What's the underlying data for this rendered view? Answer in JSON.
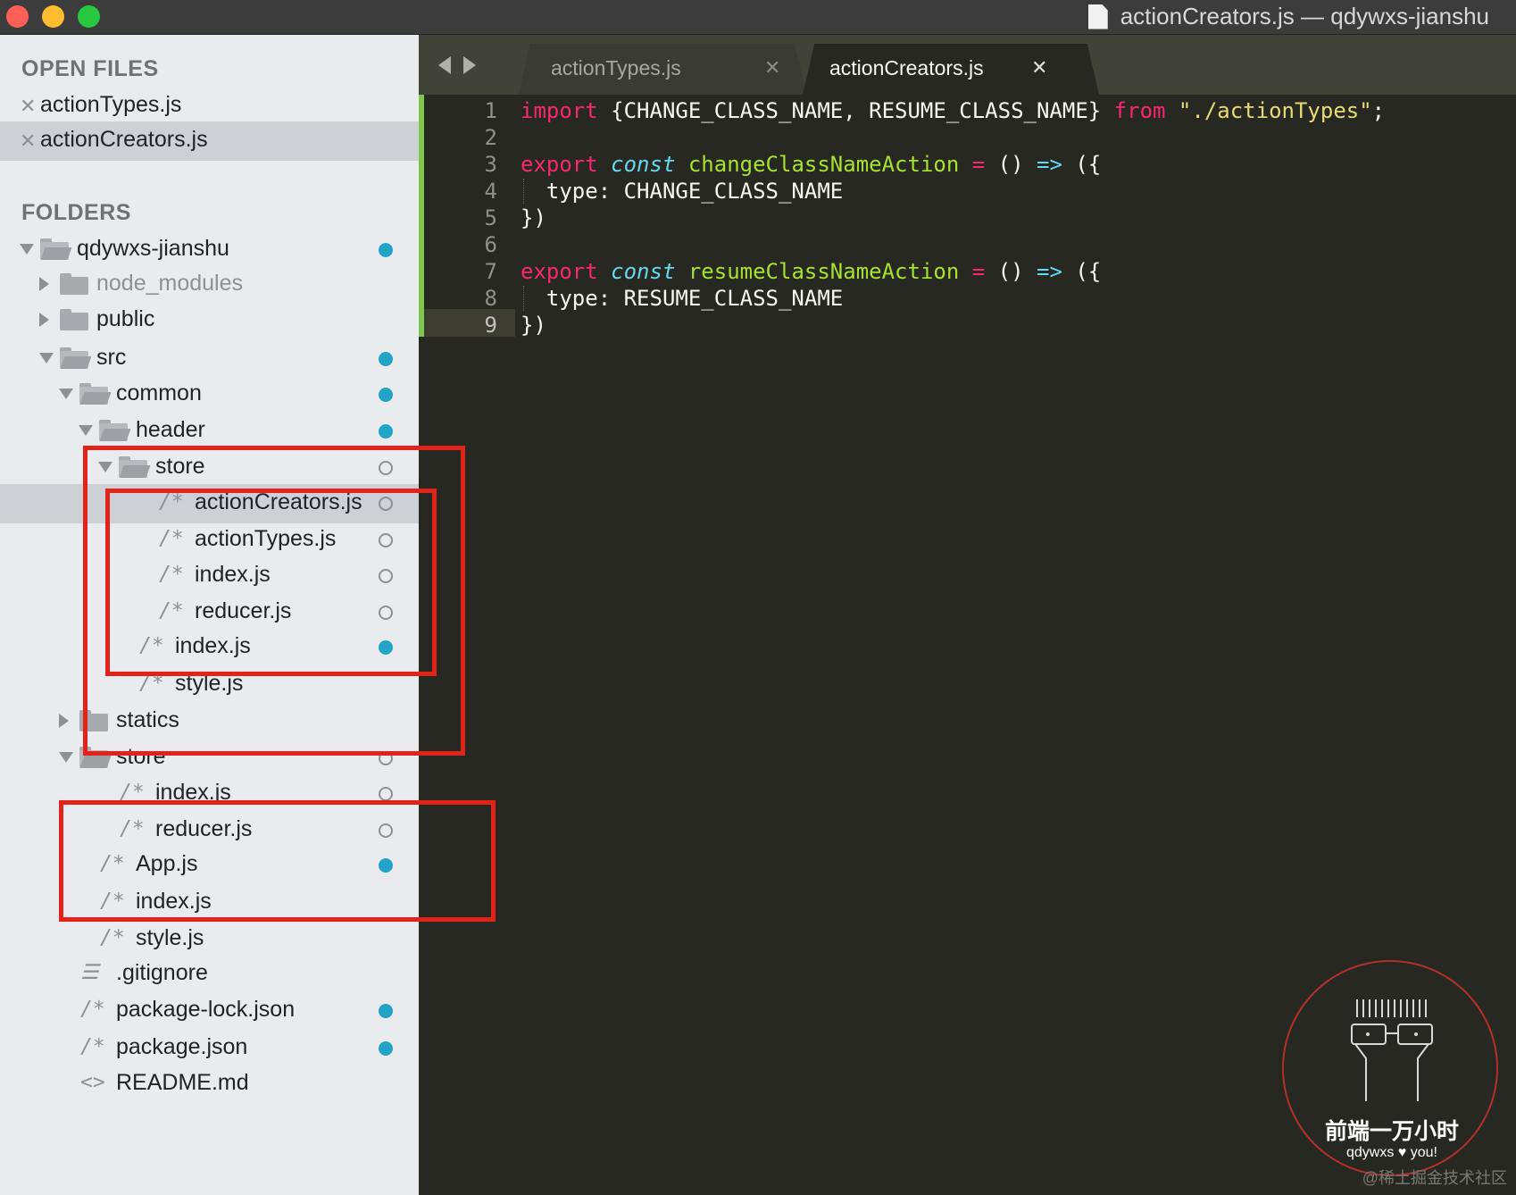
{
  "window": {
    "title": "actionCreators.js — qdywxs-jianshu"
  },
  "sidebar": {
    "open_files_heading": "OPEN FILES",
    "open_files": [
      {
        "label": "actionTypes.js",
        "selected": false
      },
      {
        "label": "actionCreators.js",
        "selected": true
      }
    ],
    "folders_heading": "FOLDERS",
    "tree": [
      {
        "label": "qdywxs-jianshu",
        "kind": "folder",
        "state": "open",
        "marker": "dot"
      },
      {
        "label": "node_modules",
        "kind": "folder",
        "state": "closed",
        "marker": "none",
        "dim": true
      },
      {
        "label": "public",
        "kind": "folder",
        "state": "closed",
        "marker": "none"
      },
      {
        "label": "src",
        "kind": "folder",
        "state": "open",
        "marker": "dot"
      },
      {
        "label": "common",
        "kind": "folder",
        "state": "open",
        "marker": "dot"
      },
      {
        "label": "header",
        "kind": "folder",
        "state": "open",
        "marker": "dot"
      },
      {
        "label": "store",
        "kind": "folder",
        "state": "open",
        "marker": "ring"
      },
      {
        "label": "actionCreators.js",
        "kind": "file",
        "icon": "/*",
        "marker": "ring",
        "selected": true
      },
      {
        "label": "actionTypes.js",
        "kind": "file",
        "icon": "/*",
        "marker": "ring"
      },
      {
        "label": "index.js",
        "kind": "file",
        "icon": "/*",
        "marker": "ring"
      },
      {
        "label": "reducer.js",
        "kind": "file",
        "icon": "/*",
        "marker": "ring"
      },
      {
        "label": "index.js",
        "kind": "file",
        "icon": "/*",
        "marker": "dot"
      },
      {
        "label": "style.js",
        "kind": "file",
        "icon": "/*",
        "marker": "none"
      },
      {
        "label": "statics",
        "kind": "folder",
        "state": "closed",
        "marker": "none"
      },
      {
        "label": "store",
        "kind": "folder",
        "state": "open",
        "marker": "ring"
      },
      {
        "label": "index.js",
        "kind": "file",
        "icon": "/*",
        "marker": "ring"
      },
      {
        "label": "reducer.js",
        "kind": "file",
        "icon": "/*",
        "marker": "ring"
      },
      {
        "label": "App.js",
        "kind": "file",
        "icon": "/*",
        "marker": "dot"
      },
      {
        "label": "index.js",
        "kind": "file",
        "icon": "/*",
        "marker": "none"
      },
      {
        "label": "style.js",
        "kind": "file",
        "icon": "/*",
        "marker": "none"
      },
      {
        "label": ".gitignore",
        "kind": "file",
        "icon": "lines",
        "marker": "none"
      },
      {
        "label": "package-lock.json",
        "kind": "file",
        "icon": "/*",
        "marker": "dot"
      },
      {
        "label": "package.json",
        "kind": "file",
        "icon": "/*",
        "marker": "dot"
      },
      {
        "label": "README.md",
        "kind": "file",
        "icon": "<>",
        "marker": "none"
      }
    ]
  },
  "editor": {
    "tabs": [
      {
        "label": "actionTypes.js",
        "active": false,
        "close": "✕"
      },
      {
        "label": "actionCreators.js",
        "active": true,
        "close": "✕"
      }
    ],
    "current_line": 9,
    "lines": [
      {
        "num": "1",
        "tokens": [
          [
            "k",
            "import"
          ],
          [
            "p",
            " {CHANGE_CLASS_NAME, RESUME_CLASS_NAME} "
          ],
          [
            "k",
            "from"
          ],
          [
            "p",
            " "
          ],
          [
            "s",
            "\"./actionTypes\""
          ],
          [
            "p",
            ";"
          ]
        ]
      },
      {
        "num": "2",
        "tokens": []
      },
      {
        "num": "3",
        "tokens": [
          [
            "k",
            "export"
          ],
          [
            "p",
            " "
          ],
          [
            "c",
            "const"
          ],
          [
            "p",
            " "
          ],
          [
            "f",
            "changeClassNameAction"
          ],
          [
            "p",
            " "
          ],
          [
            "k",
            "="
          ],
          [
            "p",
            " () "
          ],
          [
            "o",
            "=>"
          ],
          [
            "p",
            " ({"
          ]
        ]
      },
      {
        "num": "4",
        "tokens": [
          [
            "p",
            "  type: CHANGE_CLASS_NAME"
          ]
        ],
        "guide": true
      },
      {
        "num": "5",
        "tokens": [
          [
            "p",
            "})"
          ]
        ]
      },
      {
        "num": "6",
        "tokens": []
      },
      {
        "num": "7",
        "tokens": [
          [
            "k",
            "export"
          ],
          [
            "p",
            " "
          ],
          [
            "c",
            "const"
          ],
          [
            "p",
            " "
          ],
          [
            "f",
            "resumeClassNameAction"
          ],
          [
            "p",
            " "
          ],
          [
            "k",
            "="
          ],
          [
            "p",
            " () "
          ],
          [
            "o",
            "=>"
          ],
          [
            "p",
            " ({"
          ]
        ]
      },
      {
        "num": "8",
        "tokens": [
          [
            "p",
            "  type: RESUME_CLASS_NAME"
          ]
        ],
        "guide": true
      },
      {
        "num": "9",
        "tokens": [
          [
            "p",
            "})"
          ]
        ]
      }
    ]
  },
  "stamp": {
    "title": "前端一万小时",
    "subtitle": "qdywxs ♥ you!"
  },
  "credit": "@稀土掘金技术社区",
  "colors": {
    "accent_dot": "#23a3c7",
    "annotation": "#e2231a",
    "modified_gutter": "#7fc64c"
  }
}
